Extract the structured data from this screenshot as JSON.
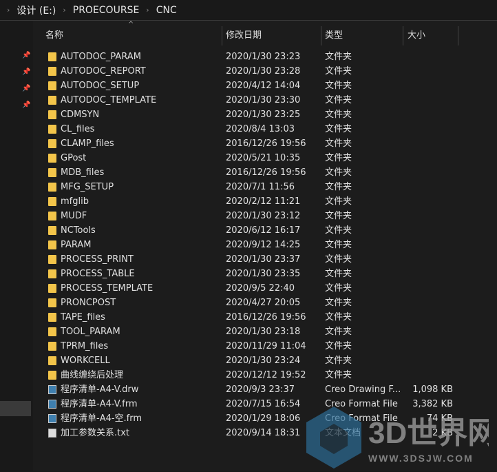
{
  "breadcrumb": [
    "设计 (E:)",
    "PROECOURSE",
    "CNC"
  ],
  "columns": {
    "name": "名称",
    "date": "修改日期",
    "type": "类型",
    "size": "大小"
  },
  "files": [
    {
      "name": "AUTODOC_PARAM",
      "date": "2020/1/30 23:23",
      "type": "文件夹",
      "size": "",
      "icon": "folder"
    },
    {
      "name": "AUTODOC_REPORT",
      "date": "2020/1/30 23:28",
      "type": "文件夹",
      "size": "",
      "icon": "folder"
    },
    {
      "name": "AUTODOC_SETUP",
      "date": "2020/4/12 14:04",
      "type": "文件夹",
      "size": "",
      "icon": "folder"
    },
    {
      "name": "AUTODOC_TEMPLATE",
      "date": "2020/1/30 23:30",
      "type": "文件夹",
      "size": "",
      "icon": "folder"
    },
    {
      "name": "CDMSYN",
      "date": "2020/1/30 23:25",
      "type": "文件夹",
      "size": "",
      "icon": "folder"
    },
    {
      "name": "CL_files",
      "date": "2020/8/4 13:03",
      "type": "文件夹",
      "size": "",
      "icon": "folder"
    },
    {
      "name": "CLAMP_files",
      "date": "2016/12/26 19:56",
      "type": "文件夹",
      "size": "",
      "icon": "folder"
    },
    {
      "name": "GPost",
      "date": "2020/5/21 10:35",
      "type": "文件夹",
      "size": "",
      "icon": "folder"
    },
    {
      "name": "MDB_files",
      "date": "2016/12/26 19:56",
      "type": "文件夹",
      "size": "",
      "icon": "folder"
    },
    {
      "name": "MFG_SETUP",
      "date": "2020/7/1 11:56",
      "type": "文件夹",
      "size": "",
      "icon": "folder"
    },
    {
      "name": "mfglib",
      "date": "2020/2/12 11:21",
      "type": "文件夹",
      "size": "",
      "icon": "folder"
    },
    {
      "name": "MUDF",
      "date": "2020/1/30 23:12",
      "type": "文件夹",
      "size": "",
      "icon": "folder"
    },
    {
      "name": "NCTools",
      "date": "2020/6/12 16:17",
      "type": "文件夹",
      "size": "",
      "icon": "folder"
    },
    {
      "name": "PARAM",
      "date": "2020/9/12 14:25",
      "type": "文件夹",
      "size": "",
      "icon": "folder"
    },
    {
      "name": "PROCESS_PRINT",
      "date": "2020/1/30 23:37",
      "type": "文件夹",
      "size": "",
      "icon": "folder"
    },
    {
      "name": "PROCESS_TABLE",
      "date": "2020/1/30 23:35",
      "type": "文件夹",
      "size": "",
      "icon": "folder"
    },
    {
      "name": "PROCESS_TEMPLATE",
      "date": "2020/9/5 22:40",
      "type": "文件夹",
      "size": "",
      "icon": "folder"
    },
    {
      "name": "PRONCPOST",
      "date": "2020/4/27 20:05",
      "type": "文件夹",
      "size": "",
      "icon": "folder"
    },
    {
      "name": "TAPE_files",
      "date": "2016/12/26 19:56",
      "type": "文件夹",
      "size": "",
      "icon": "folder"
    },
    {
      "name": "TOOL_PARAM",
      "date": "2020/1/30 23:18",
      "type": "文件夹",
      "size": "",
      "icon": "folder"
    },
    {
      "name": "TPRM_files",
      "date": "2020/11/29 11:04",
      "type": "文件夹",
      "size": "",
      "icon": "folder"
    },
    {
      "name": "WORKCELL",
      "date": "2020/1/30 23:24",
      "type": "文件夹",
      "size": "",
      "icon": "folder"
    },
    {
      "name": "曲线缠绕后处理",
      "date": "2020/12/12 19:52",
      "type": "文件夹",
      "size": "",
      "icon": "folder"
    },
    {
      "name": "程序清单-A4-V.drw",
      "date": "2020/9/3 23:37",
      "type": "Creo Drawing F...",
      "size": "1,098 KB",
      "icon": "creo"
    },
    {
      "name": "程序清单-A4-V.frm",
      "date": "2020/7/15 16:54",
      "type": "Creo Format File",
      "size": "3,382 KB",
      "icon": "creo"
    },
    {
      "name": "程序清单-A4-空.frm",
      "date": "2020/1/29 18:06",
      "type": "Creo Format File",
      "size": "74 KB",
      "icon": "creo"
    },
    {
      "name": "加工参数关系.txt",
      "date": "2020/9/14 18:31",
      "type": "文本文档",
      "size": "2 KB",
      "icon": "doc"
    }
  ],
  "watermark": {
    "title": "3D世界网",
    "url": "WWW.3DSJW.COM"
  }
}
